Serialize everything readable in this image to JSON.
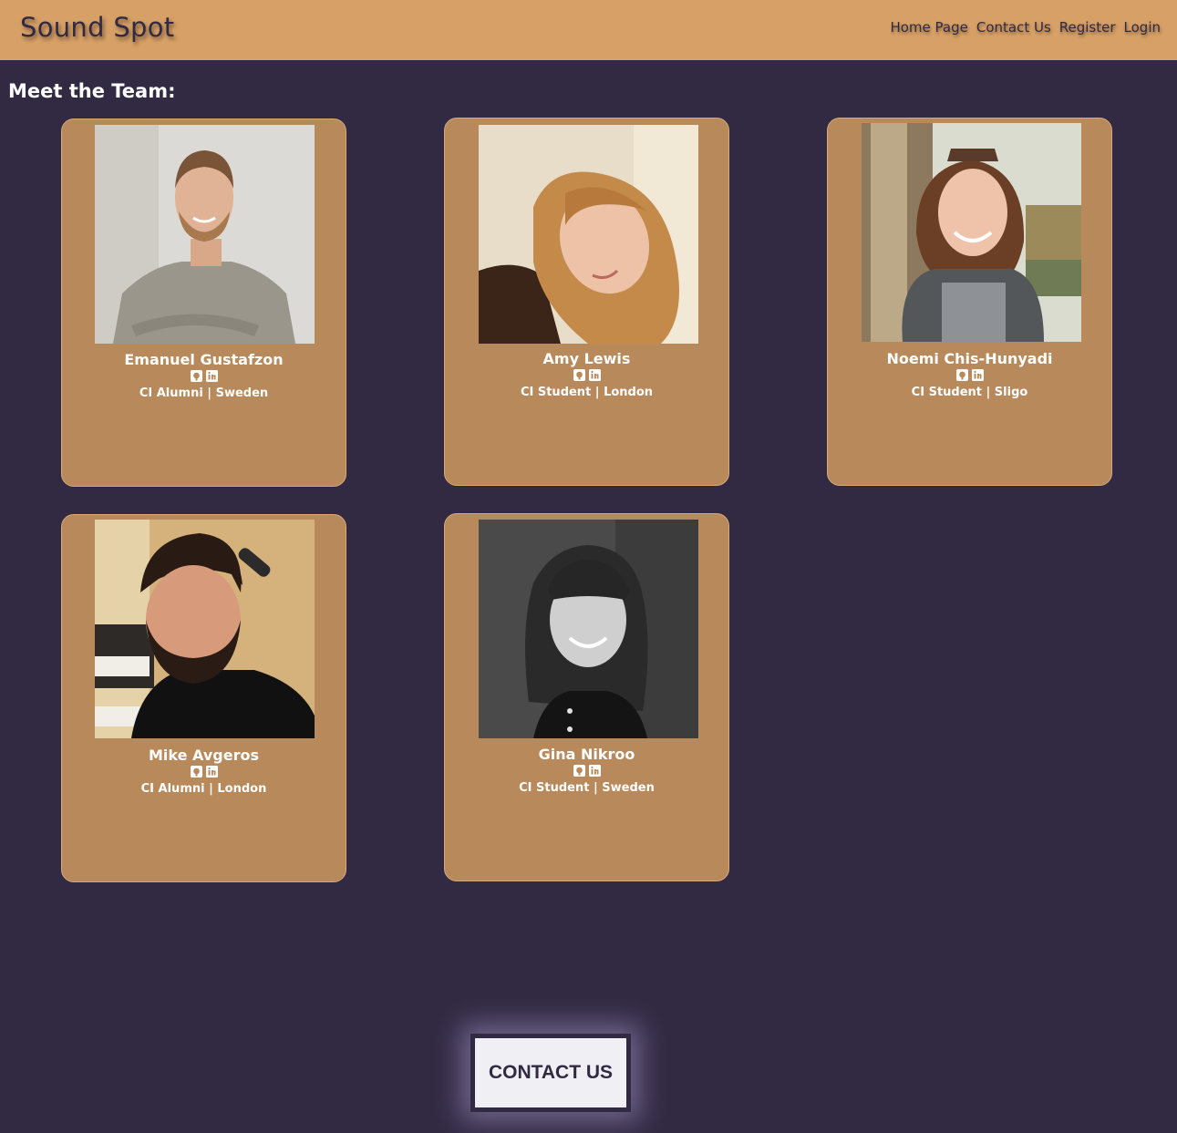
{
  "nav": {
    "brand": "Sound Spot",
    "links": [
      "Home Page",
      "Contact Us",
      "Register",
      "Login"
    ]
  },
  "team": {
    "title": "Meet the Team:",
    "members": [
      {
        "name": "Emanuel Gustafzon",
        "role": "CI Alumni | Sweden",
        "photo": "photo-emanuel"
      },
      {
        "name": "Amy Lewis",
        "role": "CI Student | London",
        "photo": "photo-amy"
      },
      {
        "name": "Noemi Chis-Hunyadi",
        "role": "CI Student | Sligo",
        "photo": "photo-noemi"
      },
      {
        "name": "Mike Avgeros",
        "role": "CI Alumni | London",
        "photo": "photo-mike"
      },
      {
        "name": "Gina Nikroo",
        "role": "CI Student | Sweden",
        "photo": "photo-gina"
      }
    ],
    "social_icons": [
      "github-icon",
      "linkedin-icon"
    ]
  },
  "contact_button": {
    "label": "CONTACT US"
  },
  "colors": {
    "background": "#322a43",
    "navbar": "#d7a066",
    "card": "#b7895b",
    "text_light": "#ffffff"
  }
}
